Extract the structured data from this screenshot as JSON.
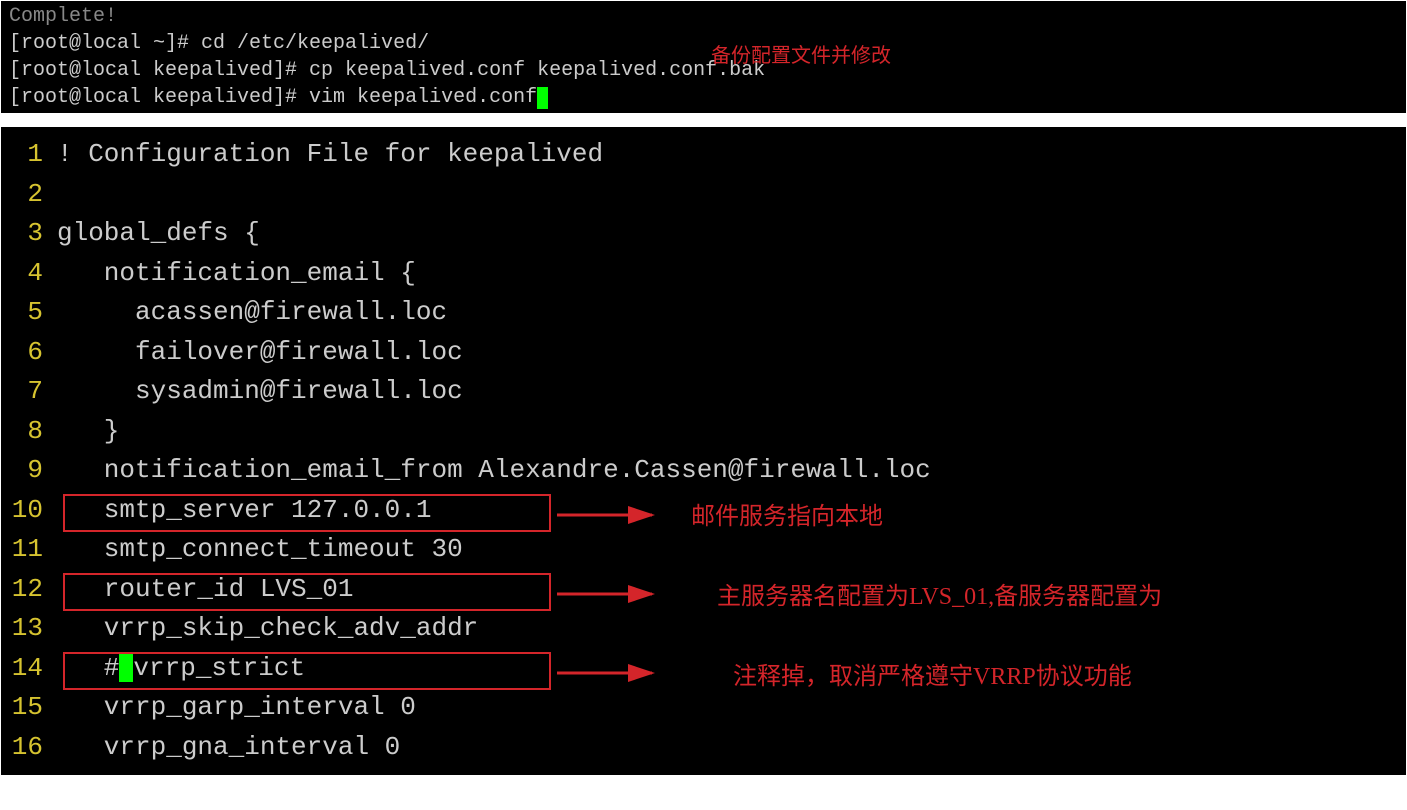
{
  "terminal": {
    "partial_line": "Complete!",
    "lines": [
      "[root@local ~]# cd /etc/keepalived/",
      "[root@local keepalived]# cp keepalived.conf keepalived.conf.bak",
      "[root@local keepalived]# vim keepalived.conf"
    ],
    "annotation": "备份配置文件并修改"
  },
  "editor": {
    "lines": [
      {
        "n": "1",
        "code": "! Configuration File for keepalived"
      },
      {
        "n": "2",
        "code": ""
      },
      {
        "n": "3",
        "code": "global_defs {"
      },
      {
        "n": "4",
        "code": "   notification_email {"
      },
      {
        "n": "5",
        "code": "     acassen@firewall.loc"
      },
      {
        "n": "6",
        "code": "     failover@firewall.loc"
      },
      {
        "n": "7",
        "code": "     sysadmin@firewall.loc"
      },
      {
        "n": "8",
        "code": "   }"
      },
      {
        "n": "9",
        "code": "   notification_email_from Alexandre.Cassen@firewall.loc"
      },
      {
        "n": "10",
        "code": "   smtp_server 127.0.0.1"
      },
      {
        "n": "11",
        "code": "   smtp_connect_timeout 30"
      },
      {
        "n": "12",
        "code": "   router_id LVS_01"
      },
      {
        "n": "13",
        "code": "   vrrp_skip_check_adv_addr"
      },
      {
        "n": "14",
        "code_pre": "   #",
        "code_post": "vrrp_strict"
      },
      {
        "n": "15",
        "code": "   vrrp_garp_interval 0"
      },
      {
        "n": "16",
        "code": "   vrrp_gna_interval 0"
      }
    ],
    "annotations": {
      "a1": "邮件服务指向本地",
      "a2": "主服务器名配置为LVS_01,备服务器配置为",
      "a3": "注释掉，取消严格遵守VRRP协议功能"
    }
  }
}
